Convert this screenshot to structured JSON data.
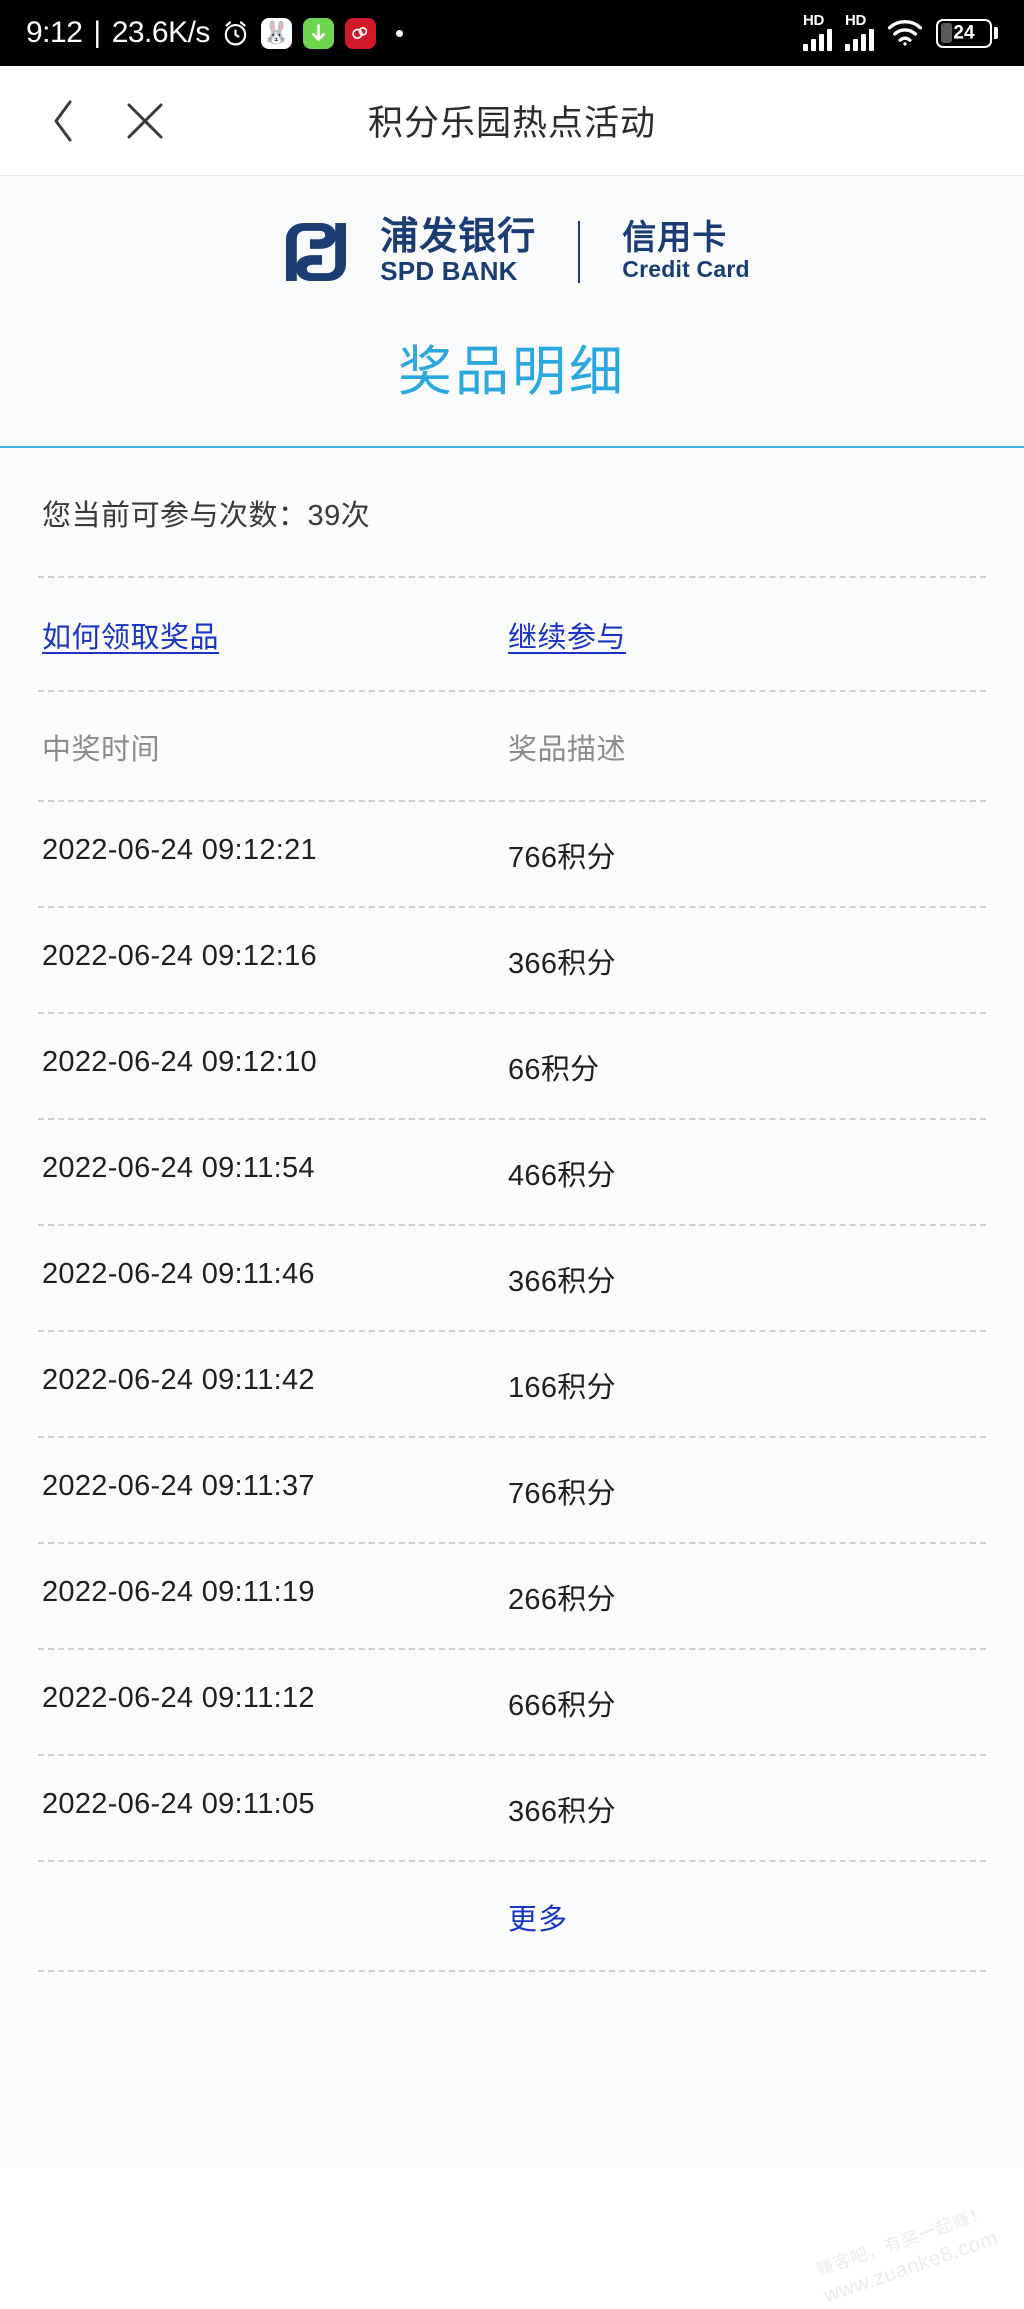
{
  "status_bar": {
    "time": "9:12",
    "separator": "|",
    "network_speed": "23.6K/s",
    "alarm_icon": "alarm-clock-icon",
    "tray_icons": [
      {
        "name": "bunny-app-icon",
        "glyph": "🐰"
      },
      {
        "name": "download-app-icon",
        "glyph": "↓"
      },
      {
        "name": "weibo-app-icon",
        "glyph": "ф"
      }
    ],
    "dot": "•",
    "signal_1_label": "HD",
    "signal_2_label": "HD",
    "wifi_icon": "wifi-icon",
    "battery_percent": "24",
    "battery_level": 24
  },
  "app_header": {
    "back_icon": "chevron-left-icon",
    "close_icon": "close-x-icon",
    "title": "积分乐园热点活动"
  },
  "brand": {
    "logo_icon": "spd-bank-logo-icon",
    "name_cn": "浦发银行",
    "name_en": "SPD BANK",
    "product_cn": "信用卡",
    "product_en": "Credit Card",
    "color": "#1c3d73"
  },
  "page": {
    "title": "奖品明细",
    "title_color": "#2aa8e0",
    "rule_color": "#3fb3e4",
    "counter_text": "您当前可参与次数：39次",
    "remaining_count": "39",
    "link_color": "#1a35c4"
  },
  "links": {
    "how_to_claim": "如何领取奖品",
    "continue": "继续参与",
    "more": "更多"
  },
  "table": {
    "headers": [
      "中奖时间",
      "奖品描述"
    ],
    "rows": [
      {
        "time": "2022-06-24 09:12:21",
        "prize": "766积分"
      },
      {
        "time": "2022-06-24 09:12:16",
        "prize": "366积分"
      },
      {
        "time": "2022-06-24 09:12:10",
        "prize": "66积分"
      },
      {
        "time": "2022-06-24 09:11:54",
        "prize": "466积分"
      },
      {
        "time": "2022-06-24 09:11:46",
        "prize": "366积分"
      },
      {
        "time": "2022-06-24 09:11:42",
        "prize": "166积分"
      },
      {
        "time": "2022-06-24 09:11:37",
        "prize": "766积分"
      },
      {
        "time": "2022-06-24 09:11:19",
        "prize": "266积分"
      },
      {
        "time": "2022-06-24 09:11:12",
        "prize": "666积分"
      },
      {
        "time": "2022-06-24 09:11:05",
        "prize": "366积分"
      }
    ]
  },
  "watermark": {
    "line1": "赚客吧，有奖一起赚！",
    "line2": "www.zuanke8.com"
  }
}
